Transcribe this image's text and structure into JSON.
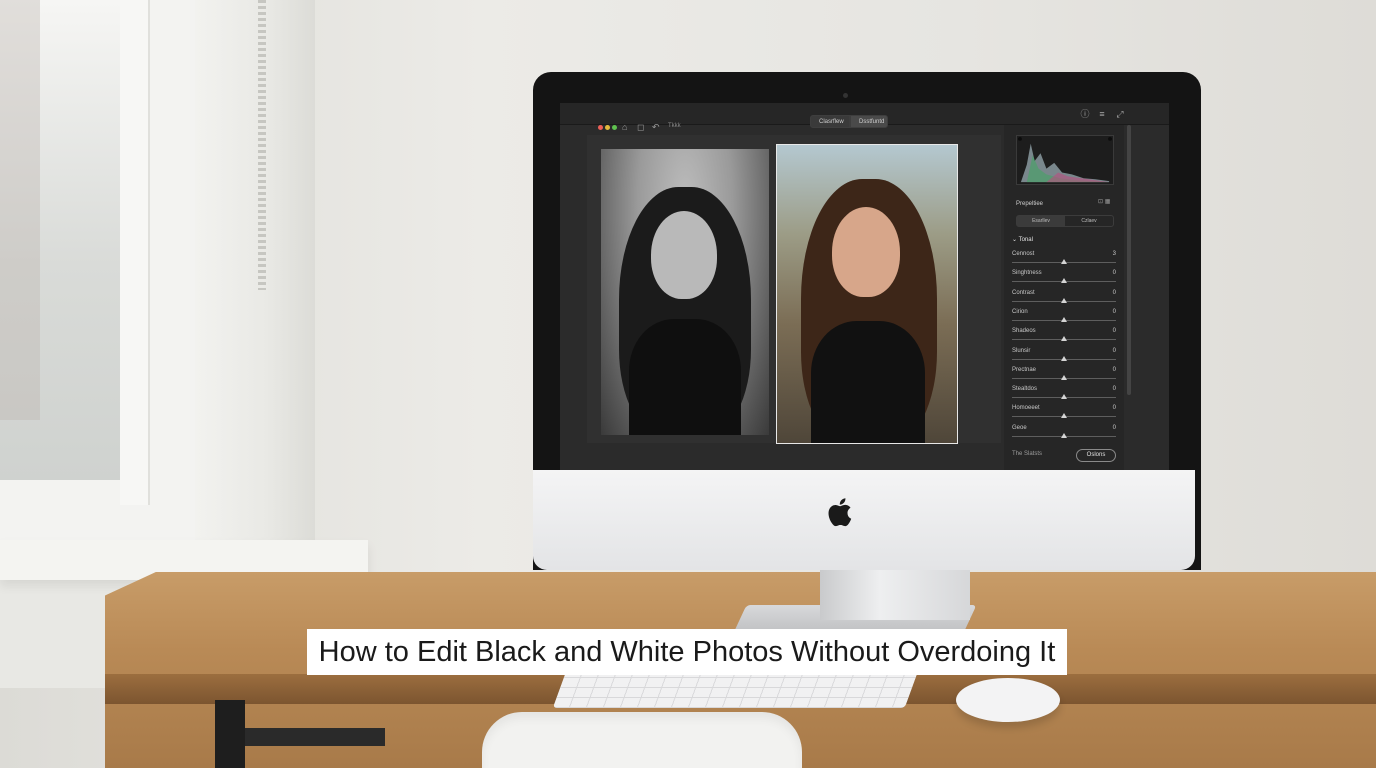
{
  "caption": "How to Edit Black and White Photos Without Overdoing It",
  "app": {
    "titlebar_text": "Tkkk",
    "view_tabs": [
      "Clasrflew",
      "Dsstfuntd"
    ],
    "panel": {
      "title": "Prepeltiee",
      "mode_tabs": [
        "Esarllev",
        "Czlaev"
      ],
      "section_title": "Tonal",
      "sliders": [
        {
          "label": "Cennost",
          "value": "3",
          "level": 0.5
        },
        {
          "label": "Singhtness",
          "value": "0",
          "level": 0.5
        },
        {
          "label": "Contrast",
          "value": "0",
          "level": 0.5
        },
        {
          "label": "Cirion",
          "value": "0",
          "level": 0.5
        },
        {
          "label": "Shadeos",
          "value": "0",
          "level": 0.5
        },
        {
          "label": "Slunsir",
          "value": "0",
          "level": 0.5
        },
        {
          "label": "Prectnae",
          "value": "0",
          "level": 0.5
        },
        {
          "label": "Stealtdos",
          "value": "0",
          "level": 0.5
        },
        {
          "label": "Homoeeet",
          "value": "0",
          "level": 0.5
        },
        {
          "label": "Geoe",
          "value": "0",
          "level": 0.5
        }
      ],
      "footer_text": "The Slatsts",
      "footer_button": "Oslons"
    }
  },
  "colors": {
    "screen_bg": "#2b2b2b",
    "panel_bg": "#262626",
    "caption_bg": "#ffffff"
  },
  "icons": [
    "home-icon",
    "crop-icon",
    "undo-icon",
    "info-icon",
    "menu-icon",
    "expand-icon",
    "apple-logo"
  ]
}
